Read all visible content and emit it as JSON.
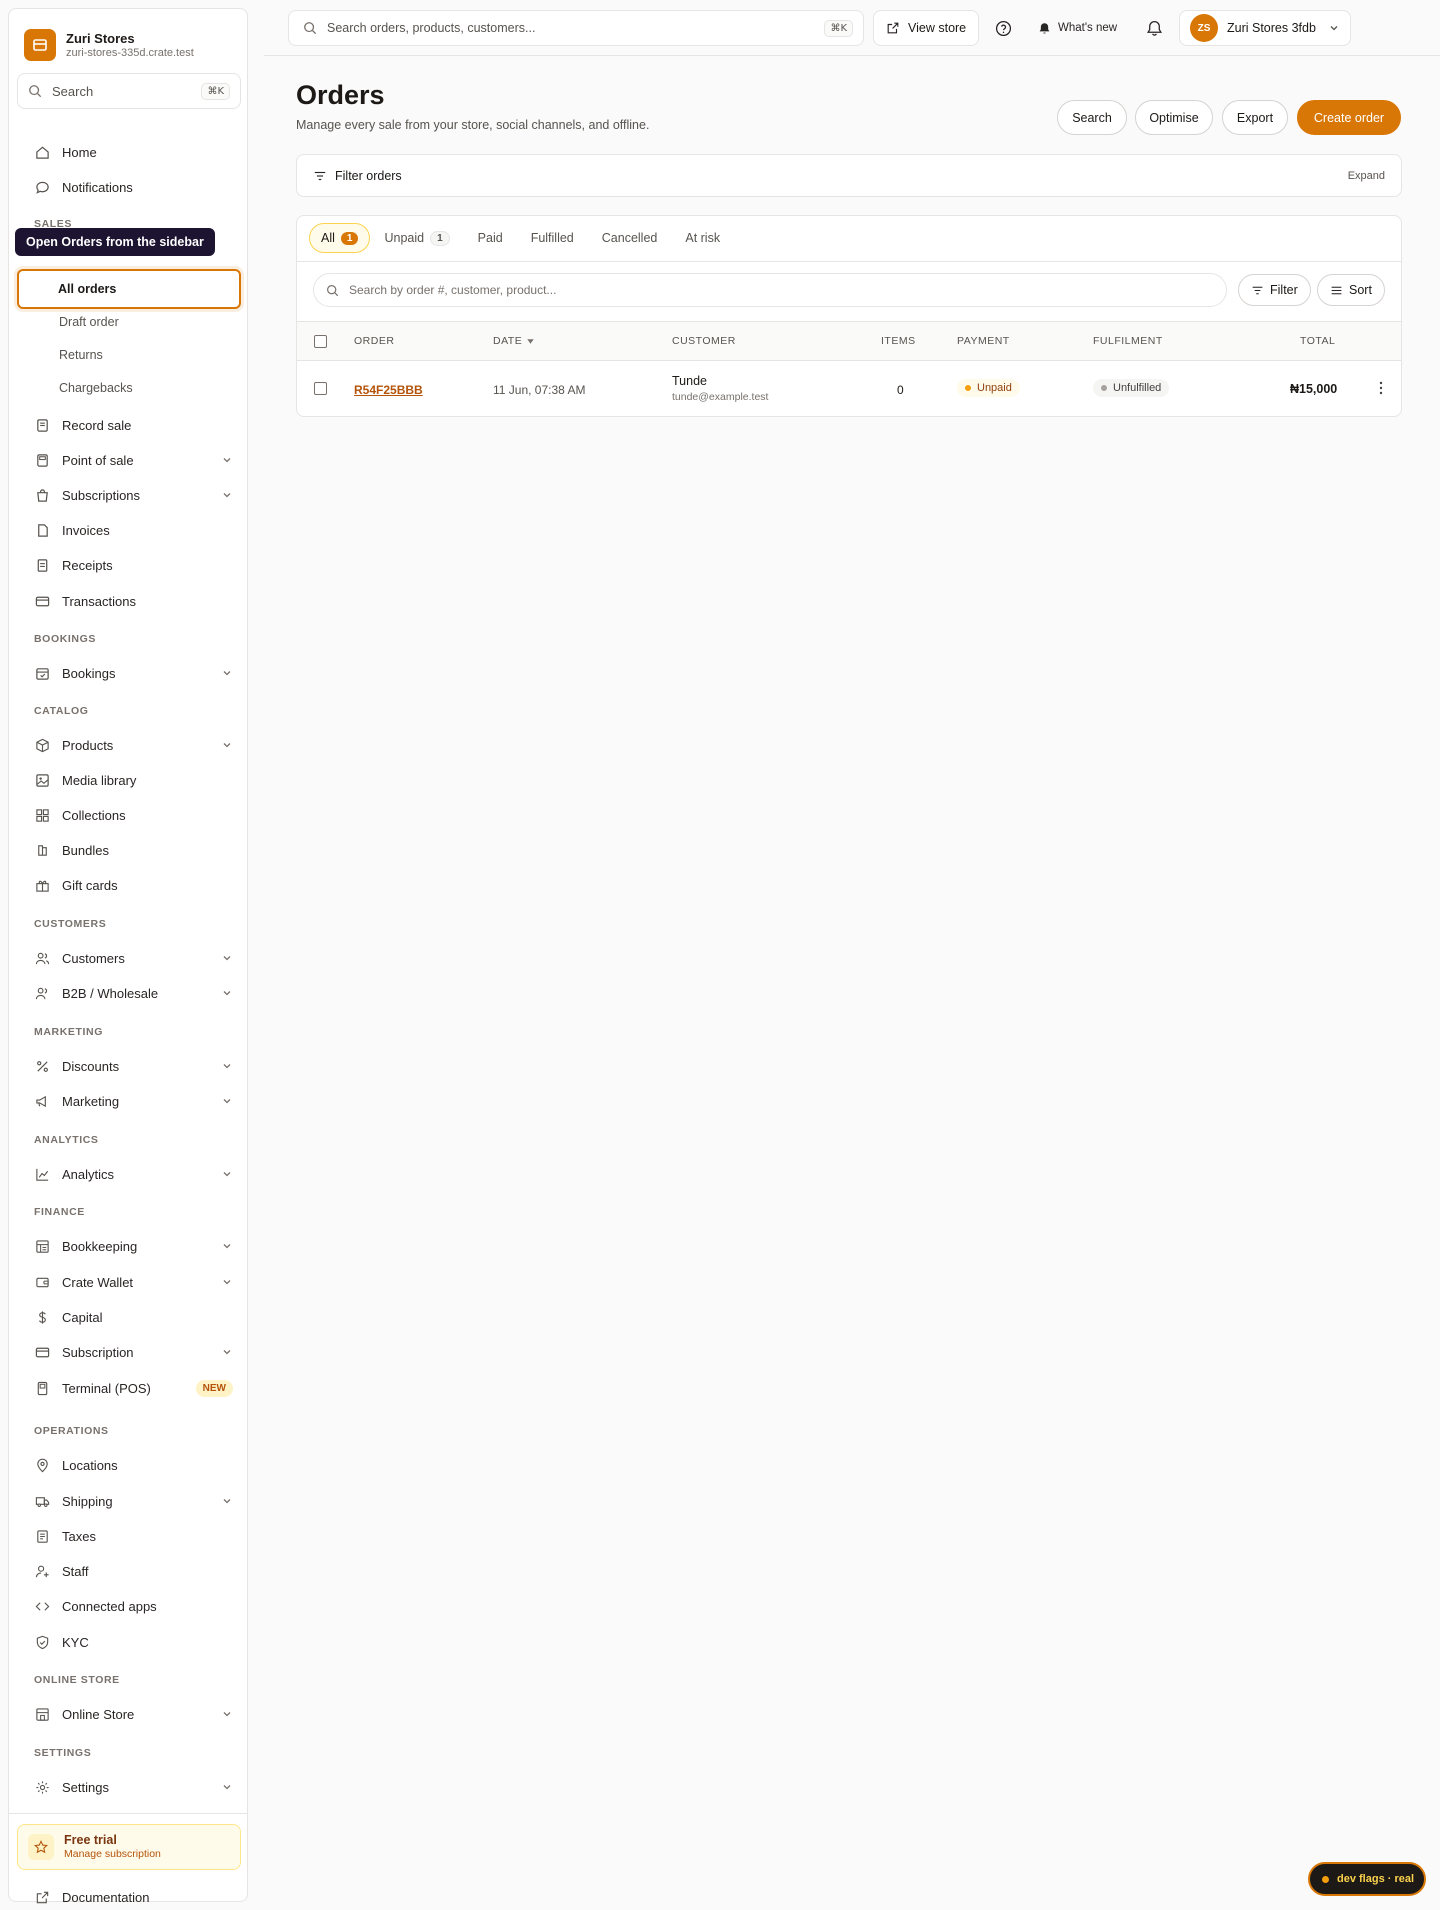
{
  "brand": {
    "name": "Zuri Stores",
    "domain": "zuri-stores-335d.crate.test"
  },
  "sidebar_search": {
    "label": "Search",
    "shortcut": "⌘K"
  },
  "tooltip": "Open Orders from the sidebar",
  "nav": {
    "home": "Home",
    "notifications": "Notifications",
    "sections": {
      "sales": "SALES",
      "bookings": "BOOKINGS",
      "catalog": "CATALOG",
      "customers": "CUSTOMERS",
      "marketing": "MARKETING",
      "analytics": "ANALYTICS",
      "finance": "FINANCE",
      "operations": "OPERATIONS",
      "online_store": "ONLINE STORE",
      "settings": "SETTINGS"
    },
    "orders_sub": [
      "All orders",
      "Draft order",
      "Returns",
      "Chargebacks"
    ],
    "record_sale": "Record sale",
    "point_of_sale": "Point of sale",
    "subscriptions": "Subscriptions",
    "invoices": "Invoices",
    "receipts": "Receipts",
    "transactions": "Transactions",
    "bookings": "Bookings",
    "products": "Products",
    "media_library": "Media library",
    "collections": "Collections",
    "bundles": "Bundles",
    "gift_cards": "Gift cards",
    "customers": "Customers",
    "b2b": "B2B / Wholesale",
    "discounts": "Discounts",
    "marketing": "Marketing",
    "analytics": "Analytics",
    "bookkeeping": "Bookkeeping",
    "crate_wallet": "Crate Wallet",
    "capital": "Capital",
    "subscription": "Subscription",
    "terminal": "Terminal (POS)",
    "terminal_badge": "NEW",
    "locations": "Locations",
    "shipping": "Shipping",
    "taxes": "Taxes",
    "staff": "Staff",
    "connected_apps": "Connected apps",
    "kyc": "KYC",
    "online_store": "Online Store",
    "settings": "Settings"
  },
  "trial": {
    "title": "Free trial",
    "subtitle": "Manage subscription"
  },
  "documentation": "Documentation",
  "topbar": {
    "search_placeholder": "Search orders, products, customers...",
    "search_shortcut": "⌘K",
    "view_store": "View store",
    "whats_new": "What's new",
    "account_initials": "ZS",
    "account_name": "Zuri Stores 3fdb"
  },
  "page": {
    "title": "Orders",
    "subtitle": "Manage every sale from your store, social channels, and offline.",
    "actions": {
      "search": "Search",
      "optimise": "Optimise",
      "export": "Export",
      "create": "Create order"
    }
  },
  "filter_panel": {
    "label": "Filter orders",
    "expand": "Expand"
  },
  "tabs": [
    {
      "label": "All",
      "count": "1"
    },
    {
      "label": "Unpaid",
      "count": "1"
    },
    {
      "label": "Paid"
    },
    {
      "label": "Fulfilled"
    },
    {
      "label": "Cancelled"
    },
    {
      "label": "At risk"
    }
  ],
  "table": {
    "search_placeholder": "Search by order #, customer, product...",
    "filter": "Filter",
    "sort": "Sort",
    "columns": {
      "order": "ORDER",
      "date": "DATE",
      "customer": "CUSTOMER",
      "items": "ITEMS",
      "payment": "PAYMENT",
      "fulfilment": "FULFILMENT",
      "total": "TOTAL"
    },
    "rows": [
      {
        "order": "R54F25BBB",
        "date": "11 Jun, 07:38 AM",
        "customer": "Tunde",
        "email": "tunde@example.test",
        "items": "0",
        "payment": "Unpaid",
        "fulfilment": "Unfulfilled",
        "total": "₦15,000"
      }
    ]
  },
  "dev_flags": "dev flags · real",
  "colors": {
    "accent": "#d97706",
    "accent_dark": "#b45309"
  }
}
